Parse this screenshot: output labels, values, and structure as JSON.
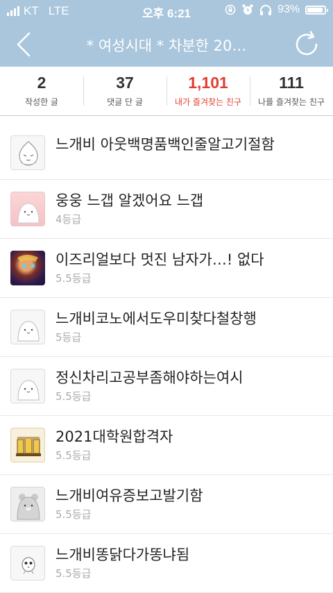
{
  "status_bar": {
    "carrier": "KT",
    "network": "LTE",
    "time": "오후 6:21",
    "battery": "93%",
    "battery_level": 0.93
  },
  "nav": {
    "title": "* 여성시대 *  차분한 20…"
  },
  "stats": [
    {
      "value": "2",
      "label": "작성한 글"
    },
    {
      "value": "37",
      "label": "댓글 단 글"
    },
    {
      "value": "1,101",
      "label": "내가 즐겨찾는 친구",
      "active": true
    },
    {
      "value": "111",
      "label": "나를 즐겨찾는 친구"
    }
  ],
  "friends": [
    {
      "name": "느개비 아웃백명품백인줄알고기절함",
      "grade": "",
      "avatar": "peach-character-icon"
    },
    {
      "name": "웅웅 느갭 알겠어요 느갭",
      "grade": "4등급",
      "avatar": "blob-character-icon"
    },
    {
      "name": "이즈리얼보다 멋진 남자가…! 없다",
      "grade": "5.5등급",
      "avatar": "game-character-photo"
    },
    {
      "name": "느개비코노에서도우미찾다철창행",
      "grade": "5등급",
      "avatar": "blob-character-icon"
    },
    {
      "name": "정신차리고공부좀해야하는여시",
      "grade": "5.5등급",
      "avatar": "blob-character-icon"
    },
    {
      "name": "2021대학원합격자",
      "grade": "5.5등급",
      "avatar": "jars-illustration"
    },
    {
      "name": "느개비여유증보고발기함",
      "grade": "5.5등급",
      "avatar": "bear-character-icon"
    },
    {
      "name": "느개비똥닭다가똥냐됨",
      "grade": "5.5등급",
      "avatar": "chick-character-icon"
    }
  ]
}
